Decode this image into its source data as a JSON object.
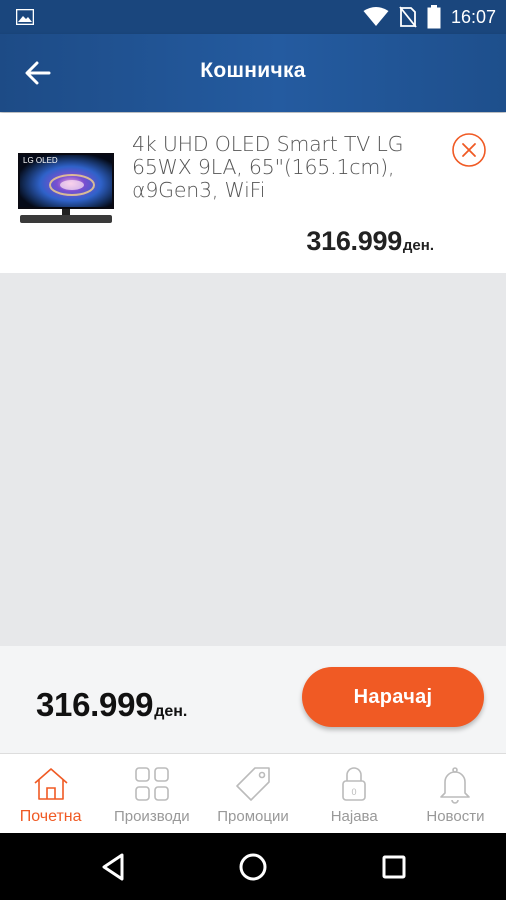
{
  "status_bar": {
    "time": "16:07",
    "icons": [
      "image-icon",
      "wifi-icon",
      "no-sim-icon",
      "battery-icon"
    ]
  },
  "header": {
    "title": "Кошничка",
    "back_icon": "arrow-left-icon"
  },
  "cart": {
    "items": [
      {
        "name": "4k UHD OLED Smart TV LG 65WX 9LA, 65\"(165.1cm), α9Gen3, WiFi",
        "thumb_brand": "LG OLED",
        "price": "316.999",
        "currency": "ден.",
        "remove_icon": "close-circle-icon"
      }
    ]
  },
  "summary": {
    "total": "316.999",
    "currency": "ден.",
    "order_label": "Нарачај"
  },
  "bottom_nav": {
    "items": [
      {
        "label": "Почетна",
        "icon": "home-icon",
        "active": true
      },
      {
        "label": "Производи",
        "icon": "grid-icon",
        "active": false
      },
      {
        "label": "Промоции",
        "icon": "tag-icon",
        "active": false
      },
      {
        "label": "Најава",
        "icon": "lock-icon",
        "active": false
      },
      {
        "label": "Новости",
        "icon": "bell-icon",
        "active": false
      }
    ]
  },
  "system_nav": {
    "icons": [
      "back-triangle-icon",
      "home-circle-icon",
      "recents-square-icon"
    ]
  },
  "colors": {
    "header_blue": "#1d4b86",
    "accent_orange": "#f05a24",
    "nav_gray": "#999999"
  }
}
